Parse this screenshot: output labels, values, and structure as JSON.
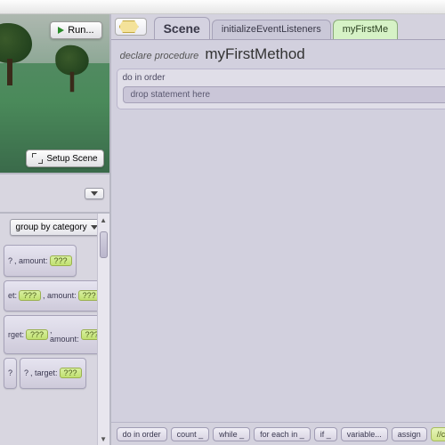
{
  "scene": {
    "run_label": "Run...",
    "setup_label": "Setup Scene"
  },
  "methods_panel": {
    "group_label": "group by category",
    "tiles": [
      {
        "pre": "?",
        "mid": ", amount:",
        "slot": "???"
      },
      {
        "pre": "et:",
        "slot1": "???",
        "mid": ", amount:",
        "slot2": "???"
      },
      {
        "pre": "rget:",
        "slot1": "???",
        "mid": ", amount:",
        "slot2": "???"
      },
      {
        "pre": "?",
        "mid": "",
        "slot": ""
      },
      {
        "pre": "?",
        "mid": ", target:",
        "slot": "???"
      }
    ]
  },
  "tabs": {
    "scene": "Scene",
    "init": "initializeEventListeners",
    "active": "myFirstMe"
  },
  "editor": {
    "declare": "declare procedure",
    "method_name": "myFirstMethod",
    "do_in_order": "do in order",
    "drop_hint": "drop statement here"
  },
  "statements": {
    "do_in_order": "do in order",
    "count": "count _",
    "while": "while _",
    "for_each": "for each in _",
    "if": "if _",
    "variable": "variable...",
    "assign": "assign",
    "comment": "//comment"
  }
}
